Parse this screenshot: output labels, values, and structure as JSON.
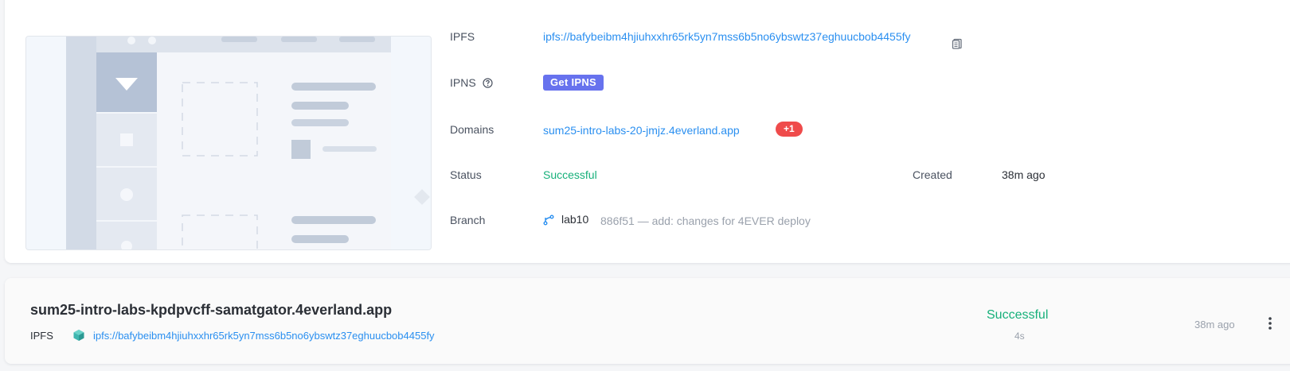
{
  "deployment": {
    "ipfs_label": "IPFS",
    "ipfs_link": "ipfs://bafybeibm4hjiuhxxhr65rk5yn7mss6b5no6ybswtz37eghuucbob4455fy",
    "ipns_label": "IPNS",
    "get_ipns_button": "Get IPNS",
    "domains_label": "Domains",
    "domain_link": "sum25-intro-labs-20-jmjz.4everland.app",
    "domain_extra_badge": "+1",
    "status_label": "Status",
    "status_value": "Successful",
    "created_label": "Created",
    "created_value": "38m ago",
    "branch_label": "Branch",
    "branch_name": "lab10",
    "commit_text": "886f51 — add: changes for 4EVER deploy"
  },
  "deploy_list": [
    {
      "title": "sum25-intro-labs-kpdpvcff-samatgator.4everland.app",
      "ipfs_label": "IPFS",
      "ipfs_link": "ipfs://bafybeibm4hjiuhxxhr65rk5yn7mss6b5no6ybswtz37eghuucbob4455fy",
      "status": "Successful",
      "duration": "4s",
      "time": "38m ago"
    }
  ],
  "colors": {
    "link": "#2a8ff0",
    "success": "#16b07a",
    "ipns_button": "#6772ee",
    "badge_red": "#ef4b4b"
  },
  "icons": {
    "copy": "copy-icon",
    "help": "help-circle-icon",
    "branch": "git-branch-icon",
    "cube": "ipfs-cube-icon",
    "menu": "more-vertical-icon"
  }
}
